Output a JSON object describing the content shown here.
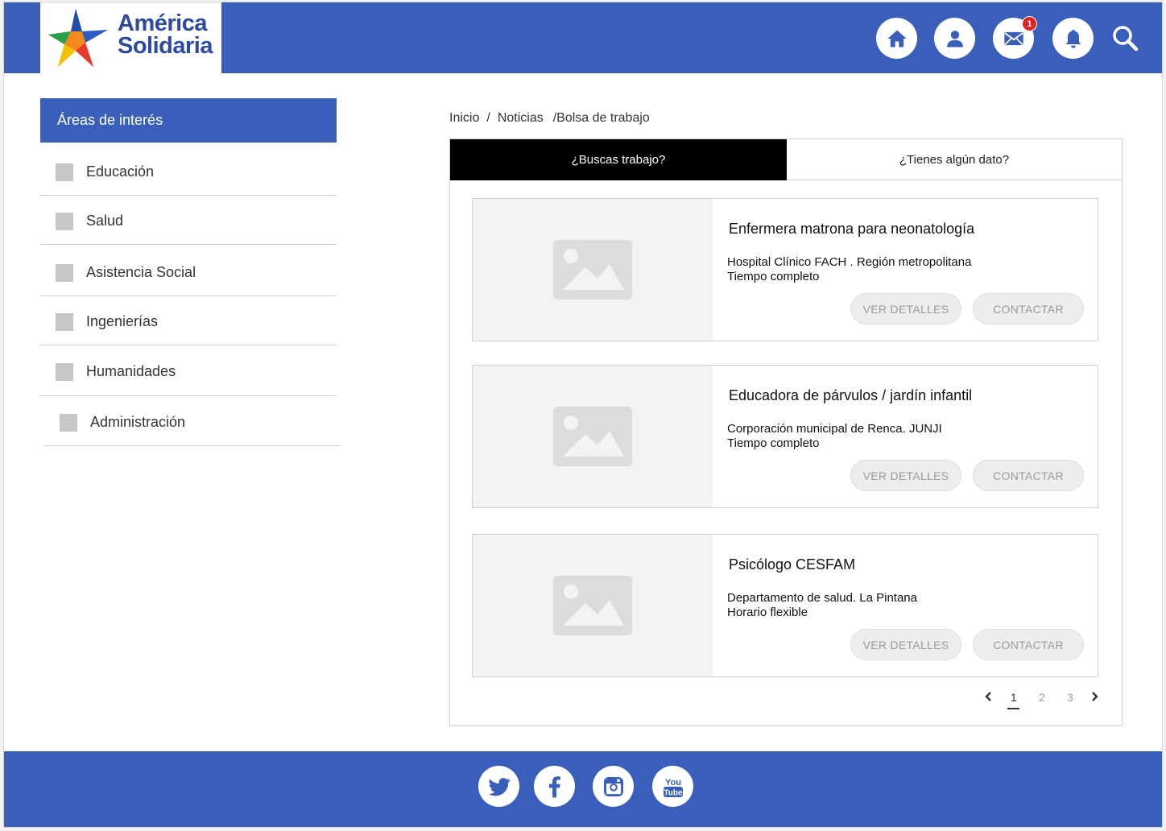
{
  "brand": {
    "line1": "América",
    "line2": "Solidaria",
    "primary_color": "#3a5fbb"
  },
  "header": {
    "icons": [
      "home-icon",
      "user-icon",
      "mail-icon",
      "bell-icon",
      "search-icon"
    ],
    "mail_badge": "1"
  },
  "sidebar": {
    "title": "Áreas de interés",
    "items": [
      {
        "label": "Educación"
      },
      {
        "label": "Salud"
      },
      {
        "label": "Asistencia Social"
      },
      {
        "label": "Ingenierías"
      },
      {
        "label": "Humanidades"
      },
      {
        "label": "Administración"
      }
    ]
  },
  "breadcrumb": {
    "home": "Inicio",
    "sep": "/",
    "news": "Noticias",
    "current": "/Bolsa de trabajo"
  },
  "tabs": {
    "active": "¿Buscas trabajo?",
    "inactive": "¿Tienes algún dato?"
  },
  "jobs": [
    {
      "title": "Enfermera matrona para neonatología",
      "org": "Hospital Clínico FACH . Región metropolitana",
      "schedule": "Tiempo completo",
      "details_label": "VER DETALLES",
      "contact_label": "CONTACTAR"
    },
    {
      "title": "Educadora de párvulos / jardín infantil",
      "org": "Corporación municipal de Renca. JUNJI",
      "schedule": "Tiempo completo",
      "details_label": "VER DETALLES",
      "contact_label": "CONTACTAR"
    },
    {
      "title": "Psicólogo CESFAM",
      "org": "Departamento de salud. La Pintana",
      "schedule": "Horario flexible",
      "details_label": "VER DETALLES",
      "contact_label": "CONTACTAR"
    }
  ],
  "pagination": {
    "pages": [
      "1",
      "2",
      "3"
    ],
    "current": "1"
  },
  "footer": {
    "social": [
      "twitter-icon",
      "facebook-icon",
      "instagram-icon",
      "youtube-icon"
    ],
    "youtube_text_1": "You",
    "youtube_text_2": "Tube"
  }
}
